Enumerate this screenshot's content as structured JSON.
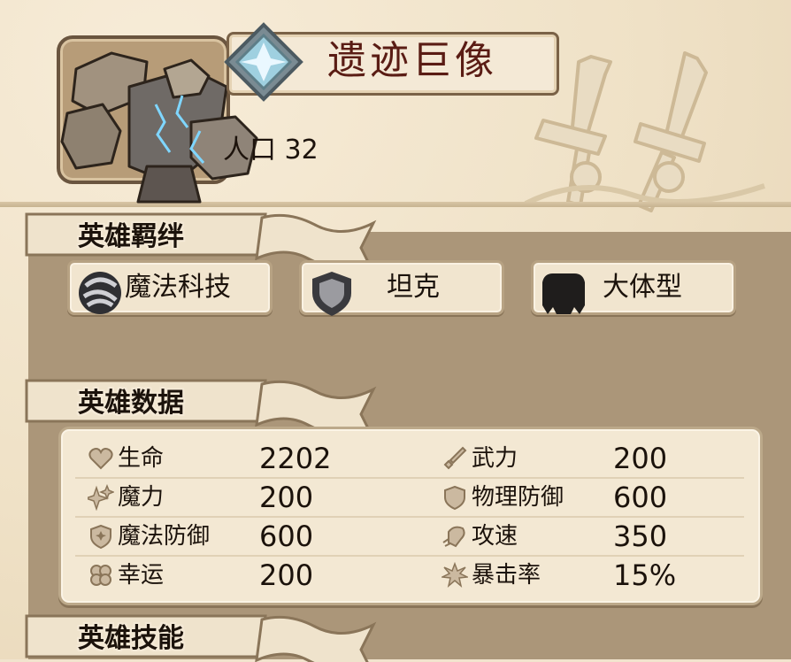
{
  "hero": {
    "name": "遗迹巨像",
    "population": "人口 32"
  },
  "sections": {
    "bonds_title": "英雄羁绊",
    "stats_title": "英雄数据",
    "skills_title": "英雄技能"
  },
  "traits": [
    {
      "label": "魔法科技",
      "icon": "magitech-icon"
    },
    {
      "label": "坦克",
      "icon": "shield-icon"
    },
    {
      "label": "大体型",
      "icon": "large-body-icon"
    }
  ],
  "stats": {
    "left": [
      {
        "label": "生命",
        "value": "2202",
        "icon": "heart-icon"
      },
      {
        "label": "魔力",
        "value": "200",
        "icon": "sparkle-icon"
      },
      {
        "label": "魔法防御",
        "value": "600",
        "icon": "magic-shield-icon"
      },
      {
        "label": "幸运",
        "value": "200",
        "icon": "clover-icon"
      }
    ],
    "right": [
      {
        "label": "武力",
        "value": "200",
        "icon": "sword-icon"
      },
      {
        "label": "物理防御",
        "value": "600",
        "icon": "shield-icon"
      },
      {
        "label": "攻速",
        "value": "350",
        "icon": "fist-icon"
      },
      {
        "label": "暴击率",
        "value": "15%",
        "icon": "burst-icon"
      }
    ]
  },
  "colors": {
    "panel": "#ab9679",
    "paper": "#f1e4cd",
    "title_text": "#5a1c14",
    "border": "#7a6247"
  }
}
